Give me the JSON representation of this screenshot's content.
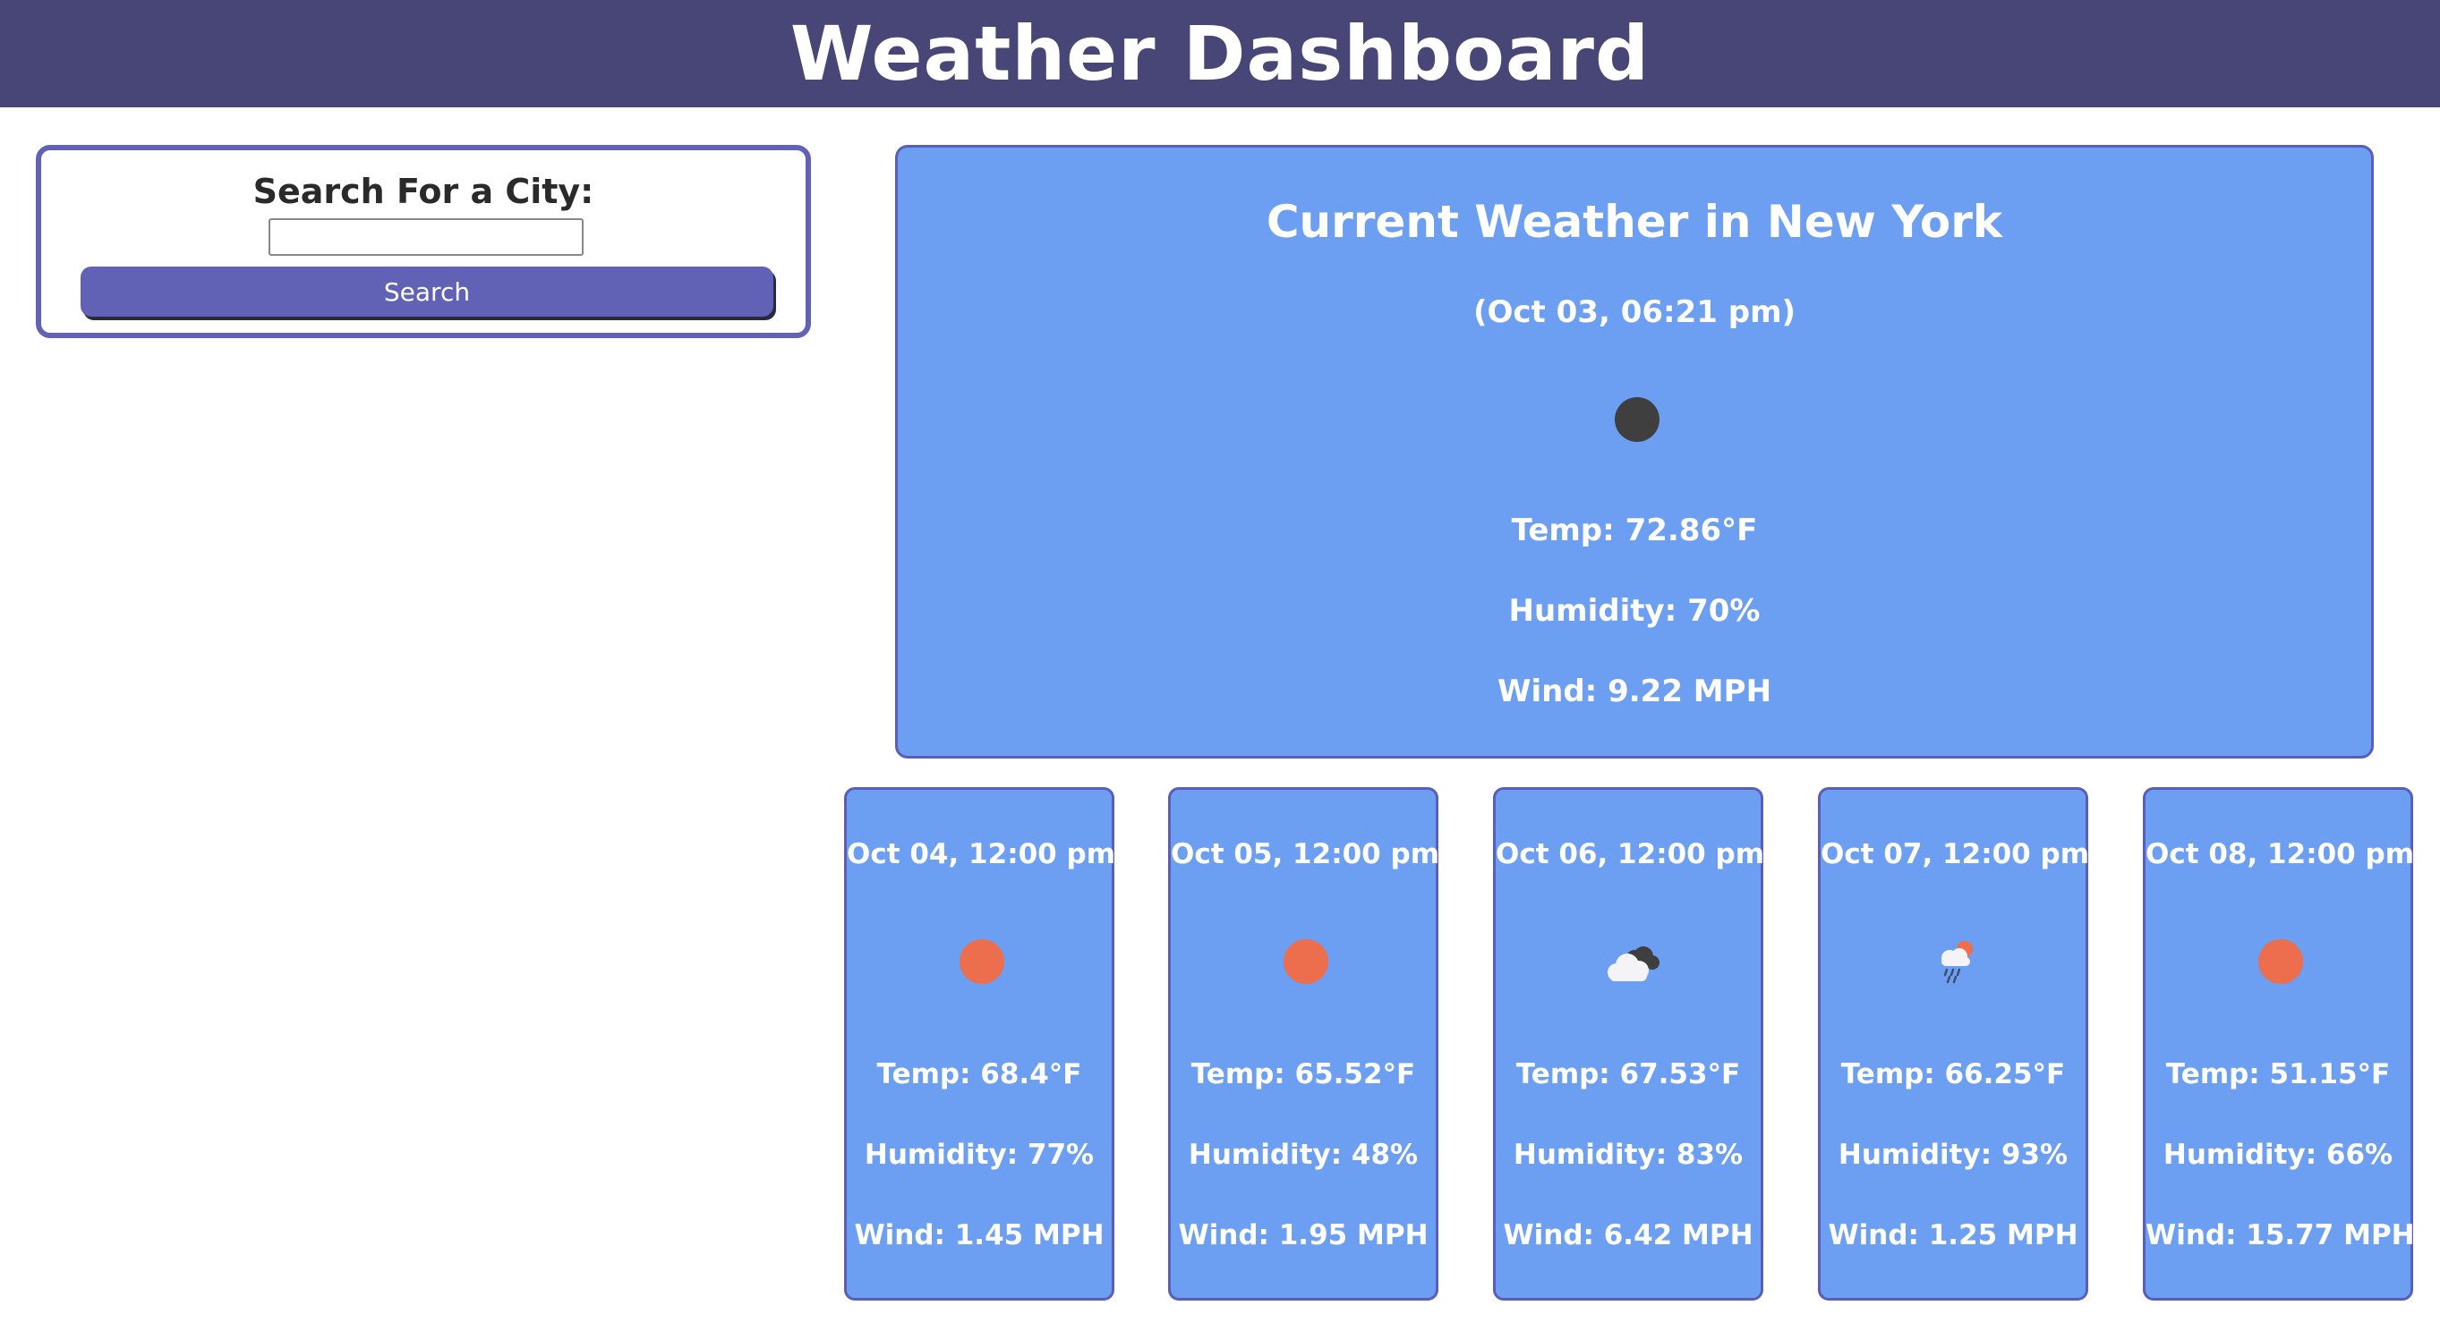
{
  "header": {
    "title": "Weather Dashboard"
  },
  "search": {
    "label": "Search For a City:",
    "input_value": "",
    "input_placeholder": "",
    "button_label": "Search"
  },
  "current": {
    "title": "Current Weather in New York",
    "date": "(Oct 03, 06:21 pm)",
    "icon": "moon-icon",
    "temp": "Temp: 72.86°F",
    "humidity": "Humidity: 70%",
    "wind": "Wind: 9.22 MPH"
  },
  "forecast": [
    {
      "date": "Oct 04, 12:00 pm",
      "icon": "sun-icon",
      "temp": "Temp: 68.4°F",
      "humidity": "Humidity: 77%",
      "wind": "Wind: 1.45 MPH"
    },
    {
      "date": "Oct 05, 12:00 pm",
      "icon": "sun-icon",
      "temp": "Temp: 65.52°F",
      "humidity": "Humidity: 48%",
      "wind": "Wind: 1.95 MPH"
    },
    {
      "date": "Oct 06, 12:00 pm",
      "icon": "clouds-icon",
      "temp": "Temp: 67.53°F",
      "humidity": "Humidity: 83%",
      "wind": "Wind: 6.42 MPH"
    },
    {
      "date": "Oct 07, 12:00 pm",
      "icon": "rain-sun-icon",
      "temp": "Temp: 66.25°F",
      "humidity": "Humidity: 93%",
      "wind": "Wind: 1.25 MPH"
    },
    {
      "date": "Oct 08, 12:00 pm",
      "icon": "sun-icon",
      "temp": "Temp: 51.15°F",
      "humidity": "Humidity: 66%",
      "wind": "Wind: 15.77 MPH"
    }
  ],
  "colors": {
    "header_bg": "#474677",
    "accent": "#6162b5",
    "card_bg": "#6c9ef2",
    "sun": "#ec6e4c",
    "moon": "#3f3f3f"
  }
}
